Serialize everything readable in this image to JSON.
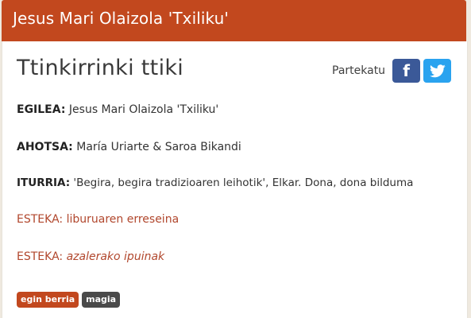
{
  "header": {
    "title": "Jesus Mari Olaizola 'Txiliku'"
  },
  "page": {
    "title": "Ttinkirrinki ttiki"
  },
  "share": {
    "label": "Partekatu",
    "facebook_glyph": "f",
    "icons": [
      "facebook-icon",
      "twitter-icon"
    ]
  },
  "details": {
    "author": {
      "key": "EGILEA:",
      "value": "Jesus Mari Olaizola 'Txiliku'"
    },
    "voice": {
      "key": "AHOTSA:",
      "value": "María Uriarte & Saroa Bikandi"
    },
    "source": {
      "key": "ITURRIA:",
      "value": "'Begira, begira tradizioaren leihotik', Elkar. Dona, dona bilduma"
    }
  },
  "links": [
    {
      "prefix": "ESTEKA:",
      "text": "liburuaren erreseina"
    },
    {
      "prefix": "ESTEKA:",
      "text": "azalerako ipuinak"
    }
  ],
  "tags": [
    "egin berria",
    "magia"
  ],
  "colors": {
    "header": "#c2481e",
    "link": "#b1472d",
    "facebook": "#3b5998",
    "twitter": "#2aa3ef",
    "tag_primary": "#c2481e",
    "tag_secondary": "#4a4a4a"
  }
}
